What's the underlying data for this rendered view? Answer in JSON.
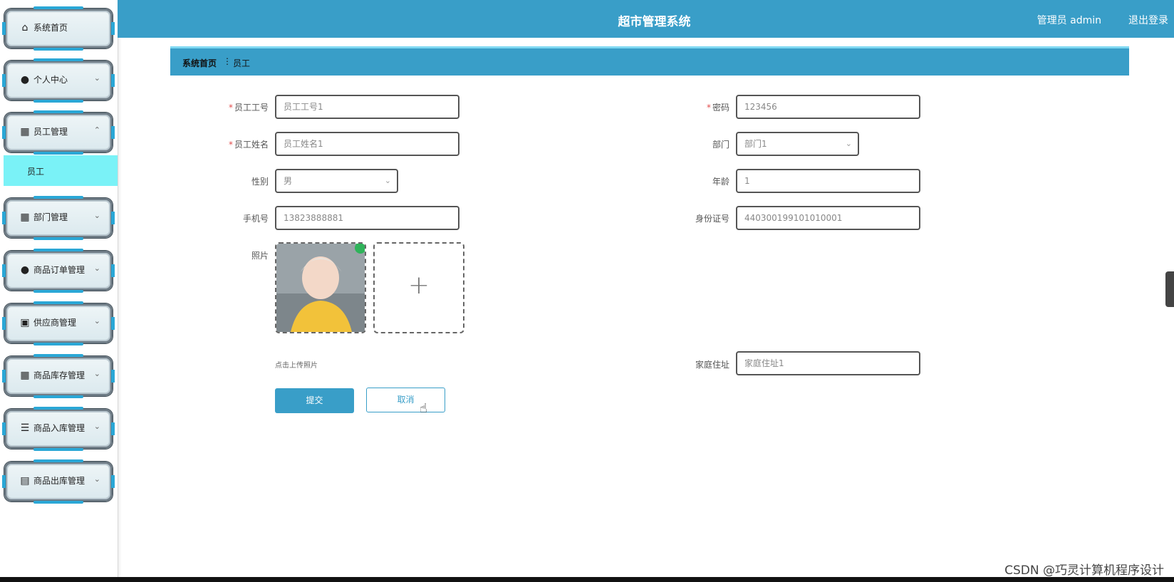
{
  "header": {
    "title": "超市管理系统",
    "user": "管理员 admin",
    "logout": "退出登录"
  },
  "sidebar": {
    "items": [
      {
        "label": "系统首页",
        "icon": "home-icon"
      },
      {
        "label": "个人中心",
        "icon": "user-icon"
      },
      {
        "label": "员工管理",
        "icon": "grid-icon",
        "expanded": true
      },
      {
        "label": "部门管理",
        "icon": "grid-icon"
      },
      {
        "label": "商品订单管理",
        "icon": "balloon-icon"
      },
      {
        "label": "供应商管理",
        "icon": "clipboard-icon"
      },
      {
        "label": "商品库存管理",
        "icon": "grid-icon"
      },
      {
        "label": "商品入库管理",
        "icon": "list-icon"
      },
      {
        "label": "商品出库管理",
        "icon": "briefcase-icon"
      }
    ],
    "sub_item": "员工"
  },
  "breadcrumb": {
    "home": "系统首页",
    "separator": "⋮",
    "current": "员工"
  },
  "form": {
    "emp_no_label": "员工工号",
    "emp_no_value": "员工工号1",
    "password_label": "密码",
    "password_value": "123456",
    "emp_name_label": "员工姓名",
    "emp_name_value": "员工姓名1",
    "dept_label": "部门",
    "dept_value": "部门1",
    "gender_label": "性别",
    "gender_value": "男",
    "age_label": "年龄",
    "age_value": "1",
    "phone_label": "手机号",
    "phone_value": "13823888881",
    "idcard_label": "身份证号",
    "idcard_value": "440300199101010001",
    "photo_label": "照片",
    "photo_hint": "点击上传照片",
    "address_label": "家庭住址",
    "address_value": "家庭住址1",
    "submit": "提交",
    "cancel": "取消",
    "required_mark": "*"
  },
  "watermark": "CSDN @巧灵计算机程序设计",
  "colors": {
    "primary": "#399ec8",
    "active_sub": "#7af2f7",
    "required": "#e24d4d"
  }
}
